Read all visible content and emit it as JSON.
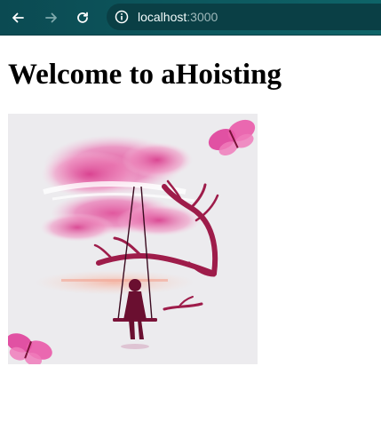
{
  "browser": {
    "url": {
      "host": "localhost",
      "port": ":3000"
    },
    "icons": {
      "back": "back-arrow-icon",
      "forward": "forward-arrow-icon",
      "reload": "reload-icon",
      "site_info": "info-icon"
    },
    "colors": {
      "toolbar": "#0d5a60",
      "address_bar": "#0a3f45"
    }
  },
  "page": {
    "title": "Welcome to aHoisting",
    "image": {
      "icon": "girl-on-swing-illustration"
    }
  }
}
